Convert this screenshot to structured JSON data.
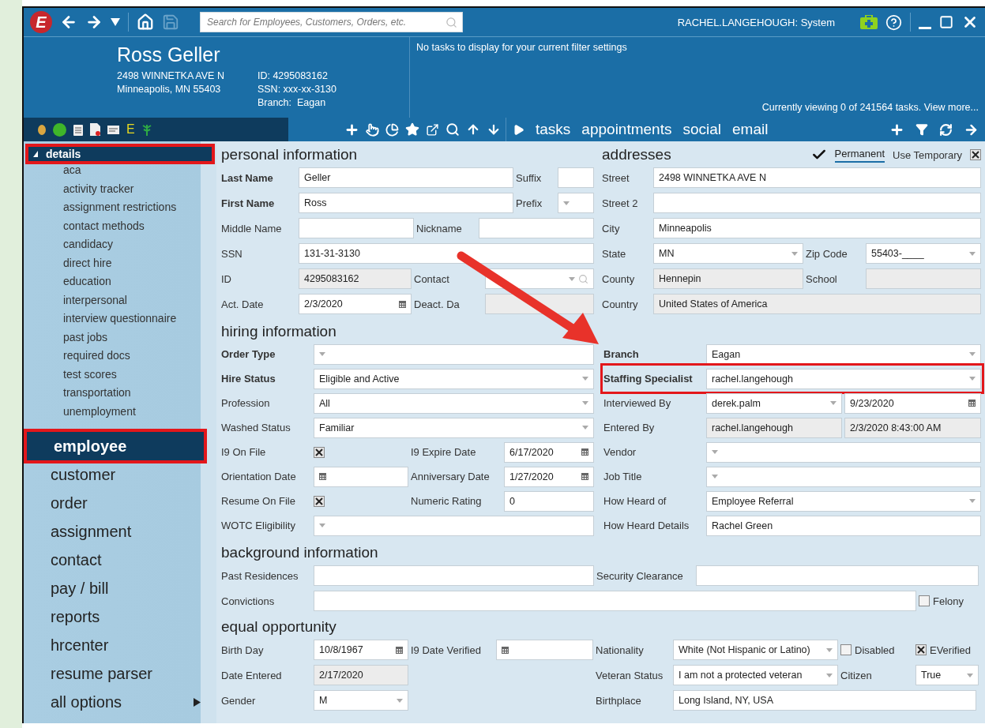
{
  "app": {
    "logo": "E",
    "search_placeholder": "Search for Employees, Customers, Orders, etc.",
    "user": "RACHEL.LANGEHOUGH: System"
  },
  "employee": {
    "name": "Ross Geller",
    "address_lines": [
      "2498 WINNETKA AVE N",
      "Minneapolis, MN 55403"
    ],
    "id_lines": [
      "ID: 4295083162",
      "SSN: xxx-xx-3130",
      "Branch:  Eagan"
    ]
  },
  "record_toolbar": {
    "letter_badge": "E"
  },
  "tasks_panel": {
    "message": "No tasks to display for your current filter settings",
    "summary": "Currently viewing 0 of 241564 tasks. View more...",
    "tabs": [
      {
        "label": "tasks"
      },
      {
        "label": "appointments"
      },
      {
        "label": "social"
      },
      {
        "label": "email"
      }
    ]
  },
  "sidebar": {
    "section": {
      "label": "details",
      "expanded": true,
      "highlighted": true,
      "children": [
        {
          "label": "aca"
        },
        {
          "label": "activity tracker"
        },
        {
          "label": "assignment restrictions"
        },
        {
          "label": "contact methods"
        },
        {
          "label": "candidacy"
        },
        {
          "label": "direct hire"
        },
        {
          "label": "education"
        },
        {
          "label": "interpersonal"
        },
        {
          "label": "interview questionnaire"
        },
        {
          "label": "past jobs"
        },
        {
          "label": "required docs"
        },
        {
          "label": "test scores"
        },
        {
          "label": "transportation"
        },
        {
          "label": "unemployment"
        }
      ]
    },
    "modules": [
      {
        "label": "employee",
        "selected": true,
        "highlighted": true
      },
      {
        "label": "customer",
        "selected": false,
        "highlighted": false
      },
      {
        "label": "order",
        "selected": false,
        "highlighted": false
      },
      {
        "label": "assignment",
        "selected": false,
        "highlighted": false
      },
      {
        "label": "contact",
        "selected": false,
        "highlighted": false
      },
      {
        "label": "pay / bill",
        "selected": false,
        "highlighted": false
      },
      {
        "label": "reports",
        "selected": false,
        "highlighted": false
      },
      {
        "label": "hrcenter",
        "selected": false,
        "highlighted": false
      },
      {
        "label": "resume parser",
        "selected": false,
        "highlighted": false
      }
    ],
    "all_options": {
      "label": "all options"
    }
  },
  "personal": {
    "title": "personal information",
    "rows": [
      [
        {
          "kind": "label",
          "text": "Last Name",
          "bold": true
        },
        {
          "kind": "input",
          "value": "Geller",
          "readonly": false
        },
        {
          "kind": "label",
          "text": "Suffix",
          "bold": false
        },
        {
          "kind": "input",
          "readonly": false
        }
      ],
      [
        {
          "kind": "label",
          "text": "First Name",
          "bold": true
        },
        {
          "kind": "input",
          "value": "Ross",
          "readonly": false
        },
        {
          "kind": "label",
          "text": "Prefix",
          "bold": false
        },
        {
          "kind": "select",
          "readonly": false
        }
      ],
      [
        {
          "kind": "label",
          "text": "Middle Name",
          "bold": false
        },
        {
          "kind": "input",
          "readonly": false
        },
        {
          "kind": "label",
          "text": "Nickname",
          "bold": false
        },
        {
          "kind": "input",
          "readonly": false
        }
      ],
      [
        {
          "kind": "label",
          "text": "SSN",
          "bold": false
        },
        {
          "kind": "input",
          "value": "131-31-3130",
          "readonly": false
        }
      ],
      [
        {
          "kind": "label",
          "text": "ID",
          "bold": false
        },
        {
          "kind": "input",
          "value": "4295083162",
          "readonly": true
        },
        {
          "kind": "label",
          "text": "Contact",
          "bold": false
        },
        {
          "kind": "lookup",
          "readonly": false
        }
      ],
      [
        {
          "kind": "label",
          "text": "Act. Date",
          "bold": false
        },
        {
          "kind": "date",
          "value": "2/3/2020",
          "readonly": false
        },
        {
          "kind": "label",
          "text": "Deact. Da",
          "bold": false
        },
        {
          "kind": "input",
          "readonly": true
        }
      ]
    ]
  },
  "addresses": {
    "title": "addresses",
    "permanent": {
      "label": "Permanent",
      "selected": true
    },
    "temporary": {
      "label": "Use Temporary",
      "checked": true
    },
    "rows": [
      [
        {
          "kind": "label",
          "text": "Street",
          "bold": false
        },
        {
          "kind": "input",
          "value": "2498 WINNETKA AVE N",
          "readonly": false
        }
      ],
      [
        {
          "kind": "label",
          "text": "Street 2",
          "bold": false
        },
        {
          "kind": "input",
          "readonly": false
        }
      ],
      [
        {
          "kind": "label",
          "text": "City",
          "bold": false
        },
        {
          "kind": "input",
          "value": "Minneapolis",
          "readonly": false
        }
      ],
      [
        {
          "kind": "label",
          "text": "State",
          "bold": false
        },
        {
          "kind": "select",
          "value": "MN",
          "readonly": false
        },
        {
          "kind": "label",
          "text": "Zip Code",
          "bold": false
        },
        {
          "kind": "select",
          "value": "55403-____",
          "readonly": false
        }
      ],
      [
        {
          "kind": "label",
          "text": "County",
          "bold": false
        },
        {
          "kind": "input",
          "value": "Hennepin",
          "readonly": true
        },
        {
          "kind": "label",
          "text": "School",
          "bold": false
        },
        {
          "kind": "input",
          "readonly": true
        }
      ],
      [
        {
          "kind": "label",
          "text": "Country",
          "bold": false
        },
        {
          "kind": "input",
          "value": "United States of America",
          "readonly": true
        }
      ]
    ]
  },
  "hiring": {
    "title": "hiring information",
    "rows": [
      {
        "highlighted": false,
        "left": [
          {
            "kind": "label",
            "text": "Order Type",
            "bold": true
          },
          {
            "kind": "select",
            "readonly": false
          }
        ],
        "right": [
          {
            "kind": "label",
            "text": "Branch",
            "bold": true
          },
          {
            "kind": "select",
            "value": "Eagan",
            "readonly": false
          }
        ]
      },
      {
        "highlighted": true,
        "left": [
          {
            "kind": "label",
            "text": "Hire Status",
            "bold": true
          },
          {
            "kind": "select",
            "value": "Eligible and Active",
            "readonly": false
          }
        ],
        "right": [
          {
            "kind": "label",
            "text": "Staffing Specialist",
            "bold": true
          },
          {
            "kind": "select",
            "value": "rachel.langehough",
            "readonly": false
          }
        ]
      },
      {
        "highlighted": false,
        "left": [
          {
            "kind": "label",
            "text": "Profession",
            "bold": false
          },
          {
            "kind": "select",
            "value": "All",
            "readonly": false
          }
        ],
        "right": [
          {
            "kind": "label",
            "text": "Interviewed By",
            "bold": false
          },
          {
            "kind": "select",
            "value": "derek.palm",
            "readonly": false
          },
          {
            "kind": "date",
            "value": "9/23/2020",
            "readonly": false
          }
        ]
      },
      {
        "highlighted": false,
        "left": [
          {
            "kind": "label",
            "text": "Washed Status",
            "bold": false
          },
          {
            "kind": "select",
            "value": "Familiar",
            "readonly": false
          }
        ],
        "right": [
          {
            "kind": "label",
            "text": "Entered By",
            "bold": false
          },
          {
            "kind": "input",
            "value": "rachel.langehough",
            "readonly": true
          },
          {
            "kind": "input",
            "value": "2/3/2020 8:43:00 AM",
            "readonly": true
          }
        ]
      },
      {
        "highlighted": false,
        "left": [
          {
            "kind": "label",
            "text": "I9 On File",
            "bold": false
          },
          {
            "kind": "checkbox",
            "checked": true
          },
          {
            "kind": "label",
            "text": "I9 Expire Date",
            "bold": false
          },
          {
            "kind": "date",
            "value": "6/17/2020",
            "readonly": false
          }
        ],
        "right": [
          {
            "kind": "label",
            "text": "Vendor",
            "bold": false
          },
          {
            "kind": "select",
            "readonly": false
          }
        ]
      },
      {
        "highlighted": false,
        "left": [
          {
            "kind": "label",
            "text": "Orientation Date",
            "bold": false
          },
          {
            "kind": "date",
            "readonly": false
          },
          {
            "kind": "label",
            "text": "Anniversary Date",
            "bold": false
          },
          {
            "kind": "date",
            "value": "1/27/2020",
            "readonly": false
          }
        ],
        "right": [
          {
            "kind": "label",
            "text": "Job Title",
            "bold": false
          },
          {
            "kind": "select",
            "readonly": false
          }
        ]
      },
      {
        "highlighted": false,
        "left": [
          {
            "kind": "label",
            "text": "Resume On File",
            "bold": false
          },
          {
            "kind": "checkbox",
            "checked": true
          },
          {
            "kind": "label",
            "text": "Numeric Rating",
            "bold": false
          },
          {
            "kind": "input",
            "value": "0",
            "readonly": false
          }
        ],
        "right": [
          {
            "kind": "label",
            "text": "How Heard of",
            "bold": false
          },
          {
            "kind": "select",
            "value": "Employee Referral",
            "readonly": false
          }
        ]
      },
      {
        "highlighted": false,
        "left": [
          {
            "kind": "label",
            "text": "WOTC Eligibility",
            "bold": false
          },
          {
            "kind": "select",
            "readonly": false
          }
        ],
        "right": [
          {
            "kind": "label",
            "text": "How Heard Details",
            "bold": false
          },
          {
            "kind": "input",
            "value": "Rachel Green",
            "readonly": false
          }
        ]
      }
    ]
  },
  "background": {
    "title": "background information",
    "rows": [
      [
        {
          "kind": "label",
          "text": "Past Residences",
          "bold": false
        },
        {
          "kind": "input",
          "readonly": false
        },
        {
          "kind": "label",
          "text": "Security Clearance",
          "bold": false
        },
        {
          "kind": "input",
          "readonly": false
        }
      ],
      [
        {
          "kind": "label",
          "text": "Convictions",
          "bold": false
        },
        {
          "kind": "input",
          "readonly": false
        },
        {
          "kind": "checkbox",
          "checked": false,
          "label": "Felony"
        }
      ]
    ]
  },
  "equal_opportunity": {
    "title": "equal opportunity",
    "rows": [
      [
        {
          "kind": "label",
          "text": "Birth Day",
          "bold": false
        },
        {
          "kind": "date",
          "value": "10/8/1967",
          "readonly": false
        },
        {
          "kind": "label",
          "text": "I9 Date Verified",
          "bold": false
        },
        {
          "kind": "date",
          "readonly": false
        },
        {
          "kind": "label",
          "text": "Nationality",
          "bold": false
        },
        {
          "kind": "select",
          "value": "White (Not Hispanic or Latino)",
          "readonly": false
        },
        {
          "kind": "checkbox",
          "checked": false,
          "label": "Disabled"
        },
        {
          "kind": "checkbox",
          "checked": true,
          "label": "EVerified"
        }
      ],
      [
        {
          "kind": "label",
          "text": "Date Entered",
          "bold": false
        },
        {
          "kind": "input",
          "value": "2/17/2020",
          "readonly": true
        },
        "",
        "",
        {
          "kind": "label",
          "text": "Veteran Status",
          "bold": false
        },
        {
          "kind": "select",
          "value": "I am not a protected veteran",
          "readonly": false
        },
        {
          "kind": "label",
          "text": "Citizen",
          "bold": false
        },
        {
          "kind": "select",
          "value": "True",
          "readonly": false
        }
      ],
      [
        {
          "kind": "label",
          "text": "Gender",
          "bold": false
        },
        {
          "kind": "select",
          "value": "M",
          "readonly": false
        },
        "",
        "",
        {
          "kind": "label",
          "text": "Birthplace",
          "bold": false
        },
        {
          "kind": "input",
          "value": "Long Island, NY, USA",
          "readonly": false
        }
      ]
    ]
  }
}
